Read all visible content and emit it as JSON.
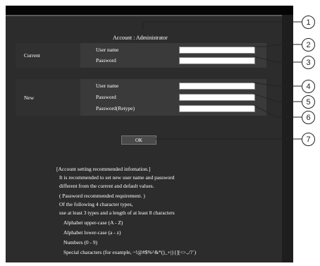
{
  "header": {
    "account_label": "Account : Administrator"
  },
  "current": {
    "section_label": "Current",
    "username_label": "User name",
    "password_label": "Password",
    "username_value": "",
    "password_value": ""
  },
  "new": {
    "section_label": "New",
    "username_label": "User name",
    "password_label": "Password",
    "retype_label": "Password(Retype)",
    "username_value": "",
    "password_value": "",
    "retype_value": ""
  },
  "ok_label": "OK",
  "info": {
    "lines": [
      "[Account setting recommended infomation.]",
      "It is recommended to set new user name and password",
      "different from the current and default values.",
      "( Password recommended requirement. )",
      "Of the following 4 character types,",
      "use at least 3 types and a length of at least 8 characters",
      "Alphabet upper-case (A - Z)",
      "Alphabet lower-case (a - z)",
      "Numbers (0 - 9)",
      "Special characters (for example, ~!@#$%^&*()_+|}{][<>.,/?`)"
    ]
  },
  "callouts": [
    "1",
    "2",
    "3",
    "4",
    "5",
    "6",
    "7"
  ]
}
